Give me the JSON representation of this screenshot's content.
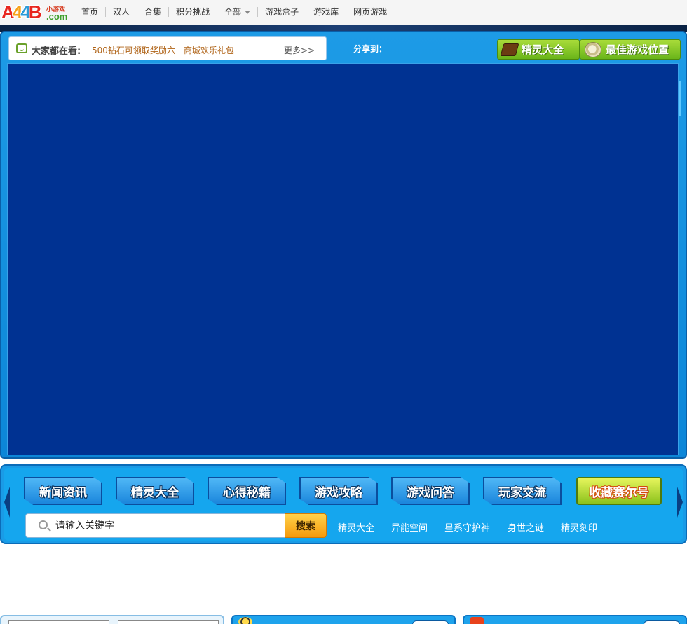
{
  "logo": {
    "text_a": "A",
    "text_mid": "4",
    "text_b": "4",
    "text_tail": "B",
    "sub": "小游戏",
    "dot_com": ".com"
  },
  "nav": {
    "items": [
      "首页",
      "双人",
      "合集",
      "积分挑战",
      "全部",
      "游戏盒子",
      "游戏库",
      "网页游戏"
    ]
  },
  "headline": {
    "label": "大家都在看:",
    "links": [
      "500钻石可领取奖励",
      "六一商城欢乐礼包"
    ],
    "more": "更多>>"
  },
  "share_label": "分享到：",
  "game_buttons": {
    "sprite_guide": "精灵大全",
    "best_position": "最佳游戏位置"
  },
  "categories": [
    "新闻资讯",
    "精灵大全",
    "心得秘籍",
    "游戏攻略",
    "游戏问答",
    "玩家交流"
  ],
  "favorite": "收藏赛尔号",
  "search": {
    "placeholder": "请输入关键字",
    "button": "搜索"
  },
  "quick_links": [
    "精灵大全",
    "异能空间",
    "星系守护神",
    "身世之谜",
    "精灵刻印"
  ],
  "colors": {
    "frame_blue": "#1d9be6",
    "game_area": "#003292",
    "green_button": "#8cc21d",
    "search_orange": "#f59a0c"
  }
}
